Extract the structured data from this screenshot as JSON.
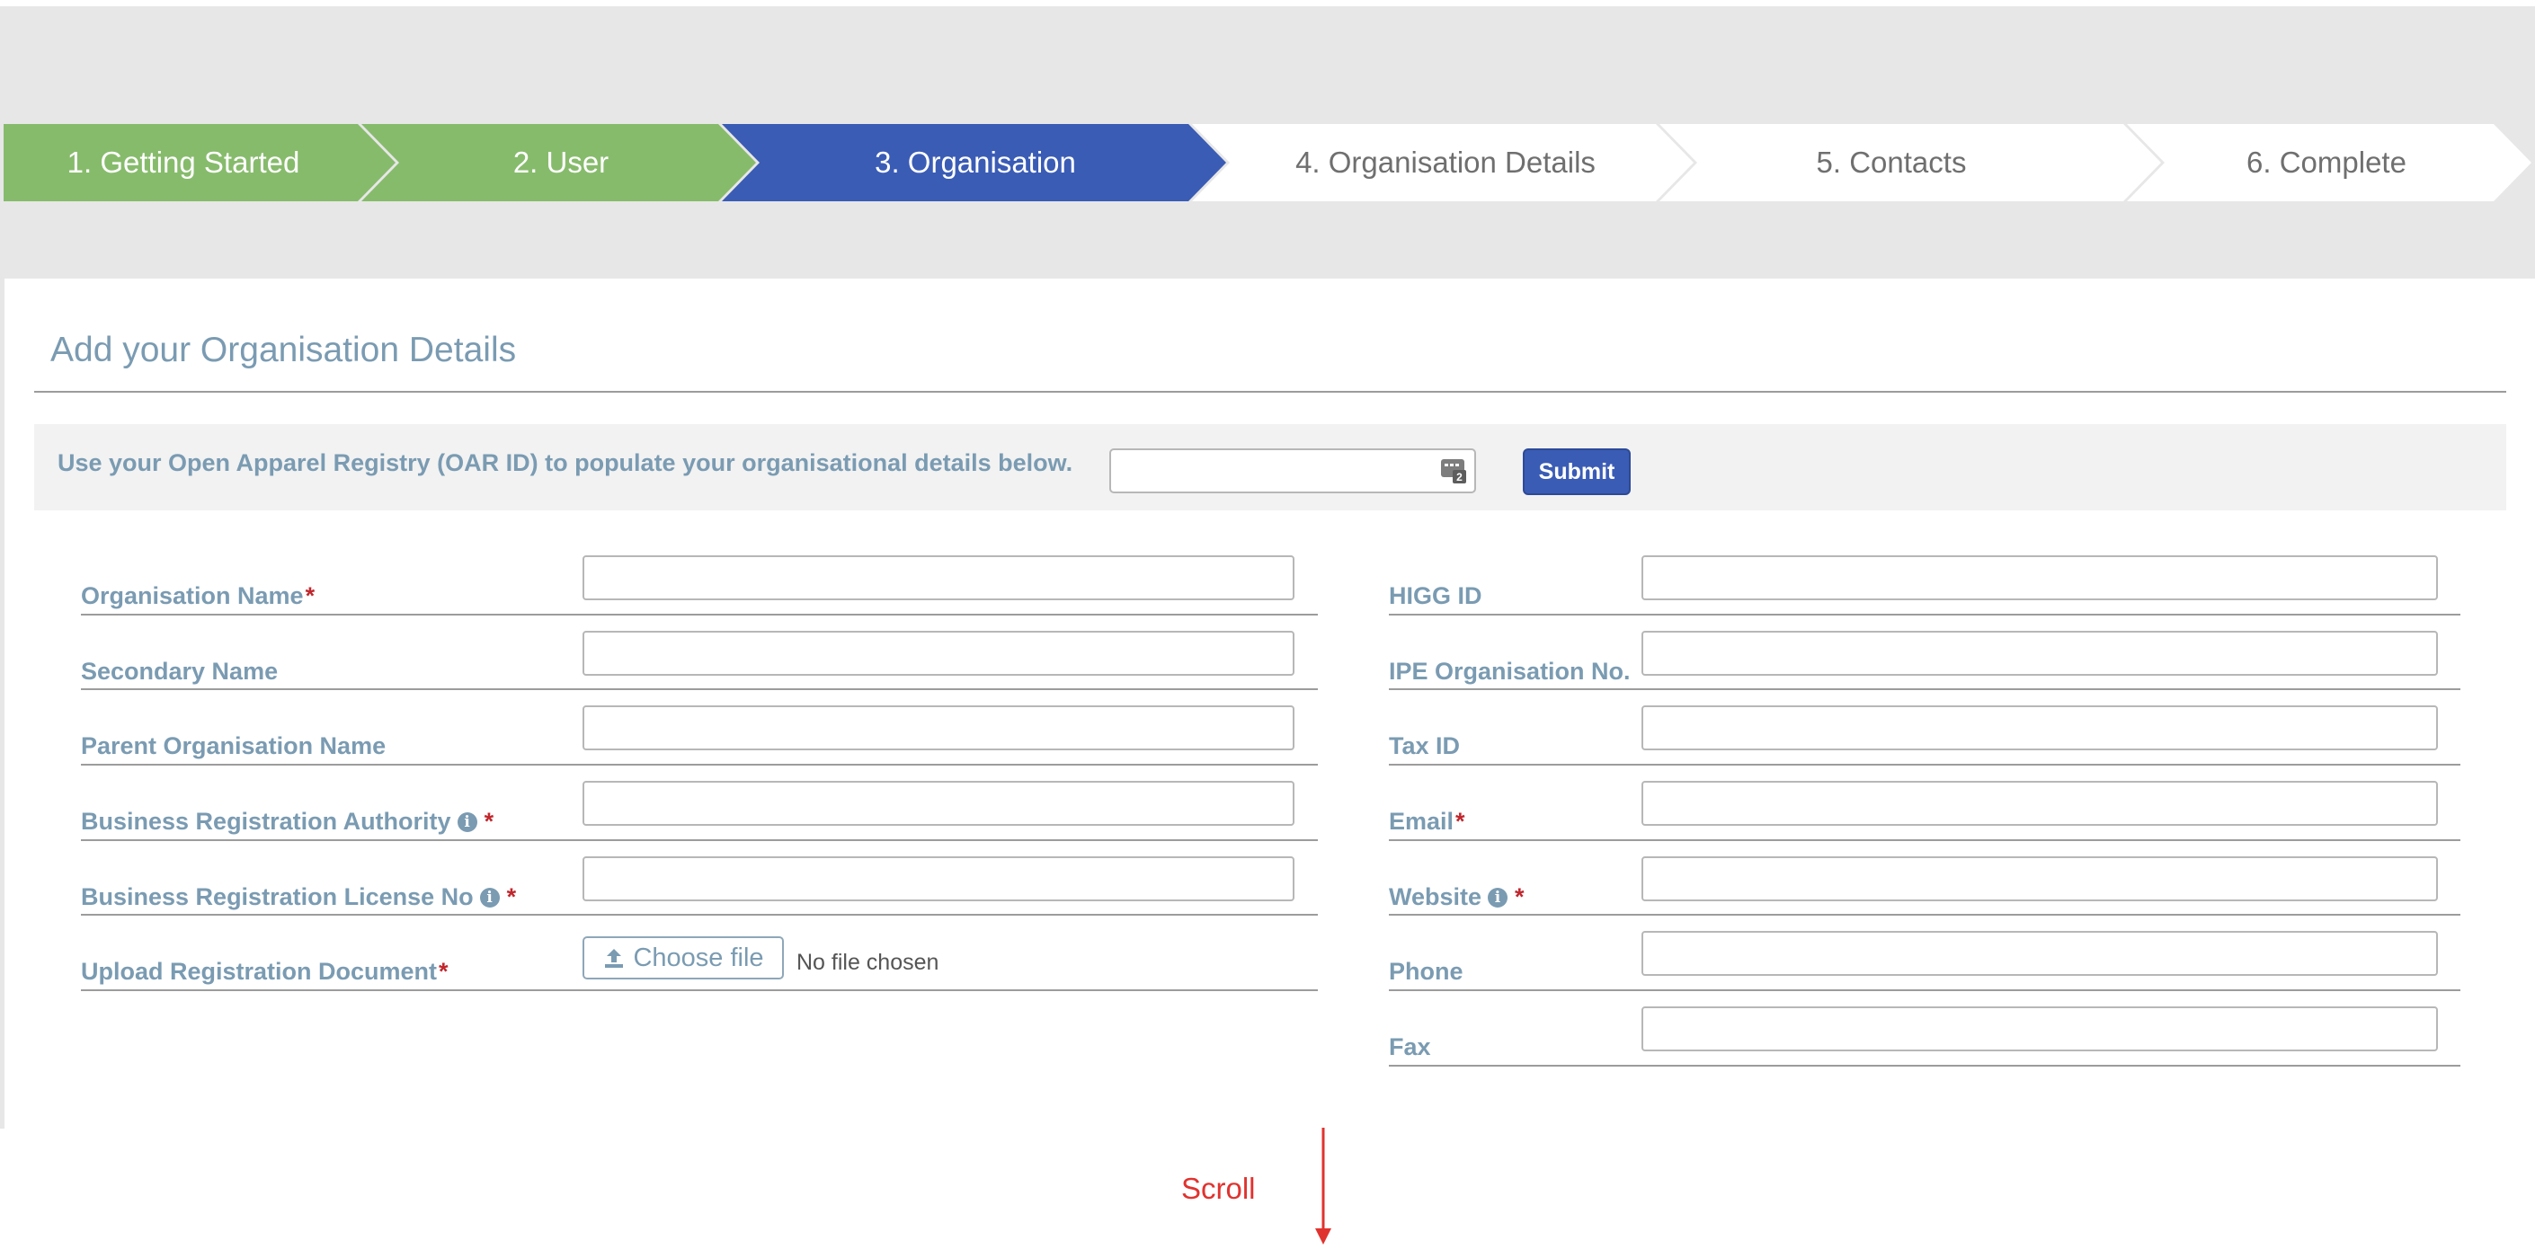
{
  "stepper": {
    "steps": [
      {
        "label": "1. Getting Started",
        "state": "done"
      },
      {
        "label": "2. User",
        "state": "done"
      },
      {
        "label": "3. Organisation",
        "state": "active"
      },
      {
        "label": "4. Organisation Details",
        "state": "todo"
      },
      {
        "label": "5. Contacts",
        "state": "todo"
      },
      {
        "label": "6. Complete",
        "state": "todo"
      }
    ],
    "colors": {
      "done": "#87bb6c",
      "active": "#3a5cb5",
      "todo": "#ffffff"
    }
  },
  "page": {
    "title": "Add your Organisation Details"
  },
  "oar": {
    "prompt": "Use your Open Apparel Registry (OAR ID) to populate your organisational details below.",
    "input_value": "",
    "input_icon": "id-card-icon",
    "submit_label": "Submit"
  },
  "form": {
    "left": [
      {
        "label": "Organisation Name",
        "required": "*",
        "value": ""
      },
      {
        "label": "Secondary Name",
        "required": "",
        "value": ""
      },
      {
        "label": "Parent Organisation Name",
        "required": "",
        "value": ""
      },
      {
        "label": "Business Registration Authority",
        "info": "i",
        "required": "*",
        "value": ""
      },
      {
        "label": "Business Registration License No",
        "info": "i",
        "required": "*",
        "value": ""
      },
      {
        "label": "Upload Registration Document",
        "required": "*",
        "choose_file_label": "Choose file",
        "file_status": "No file chosen"
      }
    ],
    "right": [
      {
        "label": "HIGG ID",
        "required": "",
        "value": ""
      },
      {
        "label": "IPE Organisation No.",
        "required": "",
        "value": ""
      },
      {
        "label": "Tax ID",
        "required": "",
        "value": ""
      },
      {
        "label": "Email",
        "required": "*",
        "value": ""
      },
      {
        "label": "Website",
        "info": "i",
        "required": "*",
        "value": ""
      },
      {
        "label": "Phone",
        "required": "",
        "value": ""
      },
      {
        "label": "Fax",
        "required": "",
        "value": ""
      }
    ]
  },
  "scroll_hint": {
    "label": "Scroll",
    "color": "#e0332f"
  }
}
